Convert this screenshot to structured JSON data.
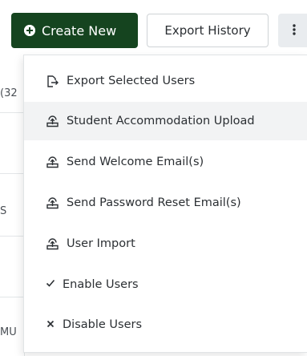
{
  "toolbar": {
    "create_label": "Create New",
    "export_history_label": "Export History"
  },
  "background": {
    "rows": [
      "32)",
      "",
      "S",
      "",
      "MU"
    ]
  },
  "menu": {
    "items": [
      {
        "label": "Export Selected Users",
        "icon": "export-icon"
      },
      {
        "label": "Student Accommodation Upload",
        "icon": "upload-icon"
      },
      {
        "label": "Send Welcome Email(s)",
        "icon": "upload-icon"
      },
      {
        "label": "Send Password Reset Email(s)",
        "icon": "upload-icon"
      },
      {
        "label": "User Import",
        "icon": "upload-icon"
      },
      {
        "label": "Enable Users",
        "icon": "check-icon"
      },
      {
        "label": "Disable Users",
        "icon": "x-icon"
      }
    ]
  },
  "colors": {
    "primary": "#15441f",
    "highlight": "#f2f3f4"
  }
}
